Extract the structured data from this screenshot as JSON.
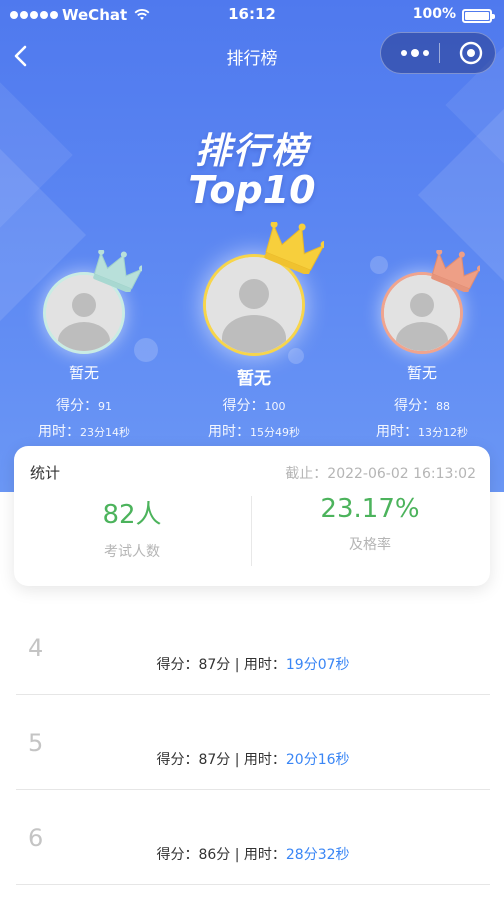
{
  "status_bar": {
    "carrier": "WeChat",
    "time": "16:12",
    "battery": "100%"
  },
  "nav": {
    "title": "排行榜"
  },
  "hero": {
    "title": "排行榜",
    "subtitle": "Top10"
  },
  "podium": [
    {
      "rank": 2,
      "name": "暂无",
      "score_label": "得分：",
      "score": "91",
      "duration_label": "用时：",
      "duration": "23分14秒",
      "ring_color": "#c9ece4",
      "crown_color": "#b8e0da"
    },
    {
      "rank": 1,
      "name": "暂无",
      "score_label": "得分：",
      "score": "100",
      "duration_label": "用时：",
      "duration": "15分49秒",
      "ring_color": "#f7d54b",
      "crown_color": "#f7cf3c"
    },
    {
      "rank": 3,
      "name": "暂无",
      "score_label": "得分：",
      "score": "88",
      "duration_label": "用时：",
      "duration": "13分12秒",
      "ring_color": "#f0a48e",
      "crown_color": "#ee9f86"
    }
  ],
  "stats": {
    "title": "统计",
    "cutoff": "截止：2022-06-02 16:13:02",
    "participants_value": "82人",
    "participants_label": "考试人数",
    "pass_rate_value": "23.17%",
    "pass_rate_label": "及格率",
    "accent": "#4cb35c"
  },
  "ranks": [
    {
      "rank": "4",
      "score_text": "得分：87分 | 用时：",
      "time": "19分07秒"
    },
    {
      "rank": "5",
      "score_text": "得分：87分 | 用时：",
      "time": "20分16秒"
    },
    {
      "rank": "6",
      "score_text": "得分：86分 | 用时：",
      "time": "28分32秒"
    }
  ],
  "colors": {
    "hero_blue": "#5b86f2",
    "time_blue": "#3a86f5"
  }
}
